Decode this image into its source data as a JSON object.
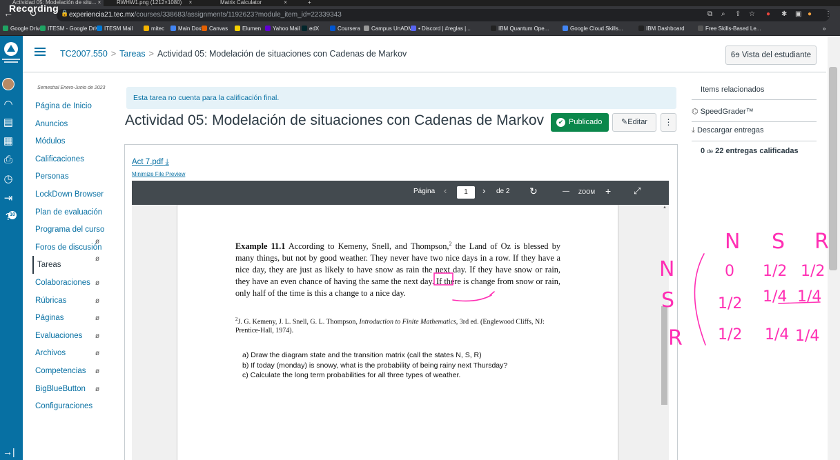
{
  "browser": {
    "tabs": [
      {
        "label": "Actividad 05: Modelación de situ...",
        "close": "×"
      },
      {
        "label": "RWHW1.png (1212×1080)",
        "close": "×"
      },
      {
        "label": "Matrix Calculator",
        "close": "×"
      }
    ],
    "new_tab": "+",
    "recording_label": "Recording",
    "url_host": "experiencia21.tec.mx",
    "url_path": "/courses/338683/assignments/1192623?module_item_id=22339343",
    "bookmarks": [
      {
        "label": "Google Drive",
        "color": "#1fa463"
      },
      {
        "label": "ITESM - Google Drive",
        "color": "#1fa463"
      },
      {
        "label": "ITESM Mail",
        "color": "#0078d4"
      },
      {
        "label": "mitec",
        "color": "#f4b400"
      },
      {
        "label": "Main Dox",
        "color": "#4285f4"
      },
      {
        "label": "Canvas",
        "color": "#e66000"
      },
      {
        "label": "Elumen",
        "color": "#f4d000"
      },
      {
        "label": "Yahoo Mail",
        "color": "#6001d2"
      },
      {
        "label": "edX",
        "color": "#02262b"
      },
      {
        "label": "Coursera",
        "color": "#0056d2"
      },
      {
        "label": "Campus UnADM",
        "color": "#999999"
      },
      {
        "label": "• Discord | #reglas |...",
        "color": "#5865f2"
      },
      {
        "label": "IBM Quantum Ope...",
        "color": "#222222"
      },
      {
        "label": "Google Cloud Skills...",
        "color": "#4285f4"
      },
      {
        "label": "IBM Dashboard",
        "color": "#222222"
      },
      {
        "label": "Free Skills-Based Le...",
        "color": "#555555"
      }
    ],
    "bookmarks_more": "»"
  },
  "gnav": {
    "badge_count": "10"
  },
  "header": {
    "course_code": "TC2007.550",
    "crumb_tareas": "Tareas",
    "crumb_current": "Actividad 05: Modelación de situaciones con Cadenas de Markov",
    "separator": ">",
    "student_view_label": "Vista del estudiante"
  },
  "course_nav": {
    "term": "Semestral Enero-Junio de 2023",
    "items": [
      {
        "label": "Página de Inicio",
        "hidden": false
      },
      {
        "label": "Anuncios",
        "hidden": false
      },
      {
        "label": "Módulos",
        "hidden": false
      },
      {
        "label": "Calificaciones",
        "hidden": false
      },
      {
        "label": "Personas",
        "hidden": false
      },
      {
        "label": "LockDown Browser",
        "hidden": false
      },
      {
        "label": "Plan de evaluación",
        "hidden": false
      },
      {
        "label": "Programa del curso",
        "hidden": false
      },
      {
        "label": "Foros de discusión",
        "hidden": true
      },
      {
        "label": "Tareas",
        "hidden": true
      },
      {
        "label": "Colaboraciones",
        "hidden": true
      },
      {
        "label": "Rúbricas",
        "hidden": true
      },
      {
        "label": "Páginas",
        "hidden": true
      },
      {
        "label": "Evaluaciones",
        "hidden": true
      },
      {
        "label": "Archivos",
        "hidden": true
      },
      {
        "label": "Competencias",
        "hidden": true
      },
      {
        "label": "BigBlueButton",
        "hidden": true
      },
      {
        "label": "Configuraciones",
        "hidden": false
      }
    ]
  },
  "main": {
    "notice": "Esta tarea no cuenta para la calificación final.",
    "title": "Actividad 05: Modelación de situaciones con Cadenas de Markov",
    "publish_label": "Publicado",
    "edit_label": "Editar",
    "kebab": "⋮",
    "file_name": "Act 7.pdf",
    "minimize_label": "Minimize File Preview"
  },
  "pdf_viewer": {
    "page_label": "Página",
    "current_page": "1",
    "total_pages": "de 2",
    "zoom_label": "ZOOM",
    "zoom_minus": "—",
    "zoom_plus": "+",
    "example_heading": "Example 11.1",
    "example_text_1": "According to Kemeny, Snell, and Thompson,",
    "footnote_mark": "2",
    "example_text_2": "the Land of Oz is blessed by many things, but not by good weather. They never have two nice days in a row. If they have a nice day, they are just as likely to have snow as rain the next day. If they have snow or rain, they have an",
    "example_word_even": "even",
    "example_text_3": "chance of having the same the next day. If there is change from snow or rain, only half of the time is this a change to a nice day.",
    "footnote_text": "J. G. Kemeny, J. L. Snell, G. L. Thompson,",
    "footnote_book": "Introduction to Finite Mathematics",
    "footnote_text_2": ", 3rd ed. (Englewood Cliffs, NJ: Prentice-Hall, 1974).",
    "questions": [
      "a)  Draw the diagram state and the transition matrix (call the states N, S, R)",
      "b)  If today (monday) is snowy, what is the probability of being rainy next Thursday?",
      "c)  Calculate the long term probabilities for all three types of weather."
    ]
  },
  "handwriting": {
    "color": "#ff2fb4",
    "col_headers": [
      "N",
      "S",
      "R"
    ],
    "row_headers": [
      "N",
      "S",
      "R"
    ],
    "row_n": [
      "0",
      "1/2",
      "1/2"
    ],
    "row_s": [
      "1/2",
      "1/4",
      "1/4"
    ],
    "row_r": [
      "1/2",
      "1/4",
      "1/4"
    ]
  },
  "right_sidebar": {
    "title": "Items relacionados",
    "speedgrader": "SpeedGrader™",
    "download": "Descargar entregas",
    "graded_count": "0",
    "graded_of": "de",
    "graded_total": "22 entregas calificadas"
  },
  "colors": {
    "canvas_blue": "#0770a3",
    "publish_green": "#0b874b",
    "text_dark": "#2d3b45"
  }
}
